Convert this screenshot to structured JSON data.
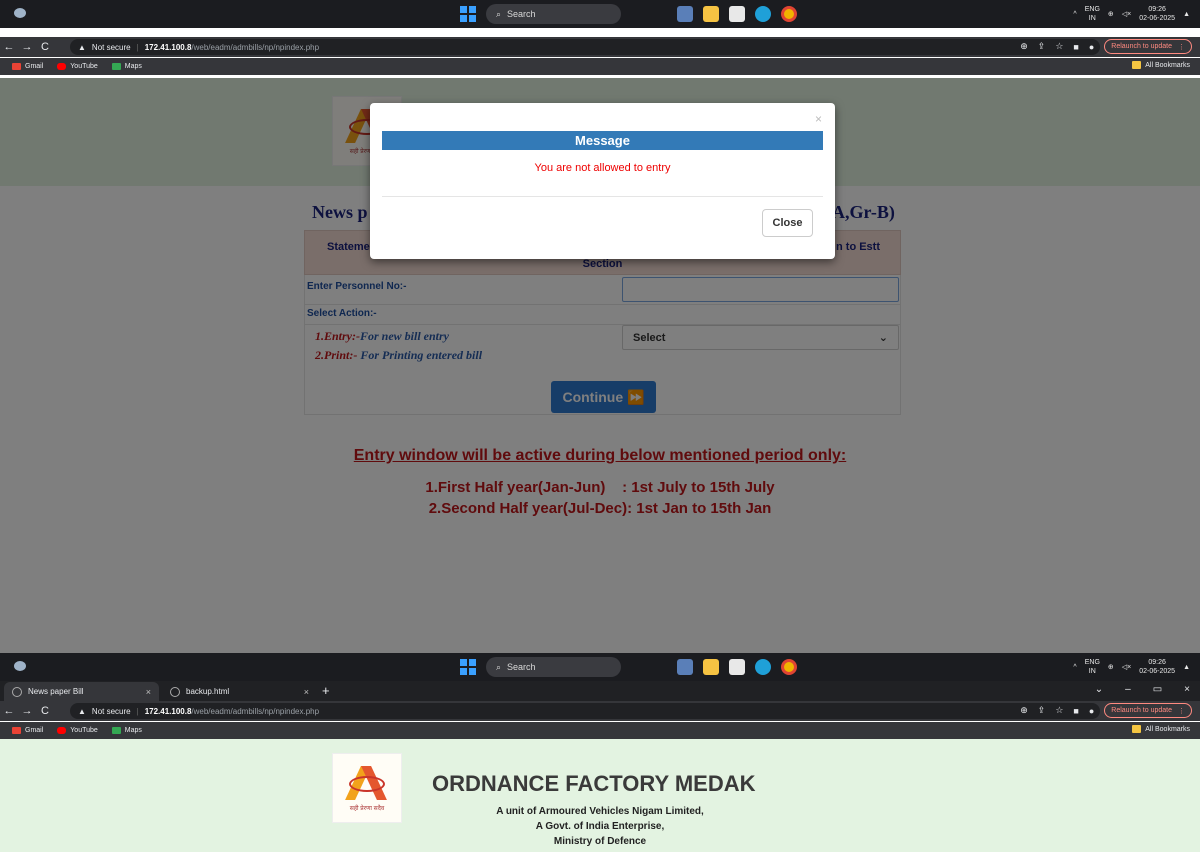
{
  "taskbar": {
    "search_label": "Search",
    "lang_top": "ENG",
    "lang_bottom": "IN",
    "time": "09:26",
    "date": "02-06-2025",
    "caret": "^",
    "sound": "◁×"
  },
  "browser": {
    "tabs": [
      {
        "label": "News paper Bill"
      },
      {
        "label": "backup.html"
      }
    ],
    "tab_close": "×",
    "new_tab": "+",
    "window_controls": [
      "⌄",
      "–",
      "▭",
      "×"
    ],
    "not_secure": "Not secure",
    "url_host": "172.41.100.8",
    "url_path": "/web/eadm/admbills/np/npindex.php",
    "relaunch": "Relaunch to update",
    "bookmarks": [
      {
        "label": "Gmail",
        "color": "#ea4335"
      },
      {
        "label": "YouTube",
        "color": "#ff0000"
      },
      {
        "label": "Maps",
        "color": "#34a853"
      }
    ],
    "all_bookmarks": "All Bookmarks"
  },
  "page": {
    "title_left": "News p",
    "title_right": "A,Gr-B)",
    "statement_left": "Statemen",
    "statement_right": "n to Estt",
    "statement_bottom": "Section",
    "personnel_label": "Enter Personnel No:-",
    "action_label": "Select Action:-",
    "entry_num": "1.Entry:-",
    "entry_desc": "For new bill entry",
    "print_num": "2.Print:-",
    "print_desc": " For Printing entered bill",
    "select_value": "Select",
    "continue_label": "Continue",
    "window_heading": "Entry window will be active during below mentioned period only:",
    "period_1": "1.First Half year(Jan-Jun)    : 1st July to 15th July",
    "period_2": "2.Second Half year(Jul-Dec): 1st Jan to 15th Jan"
  },
  "modal": {
    "close_x": "×",
    "title": "Message",
    "message": "You are not allowed to entry",
    "close_button": "Close"
  },
  "org": {
    "title": "ORDNANCE FACTORY MEDAK",
    "line1": "A unit of Armoured Vehicles Nigam Limited,",
    "line2": "A Govt. of India Enterprise,",
    "line3": "Ministry of Defence",
    "logo_text": "सही प्रेरणा सदैव"
  }
}
